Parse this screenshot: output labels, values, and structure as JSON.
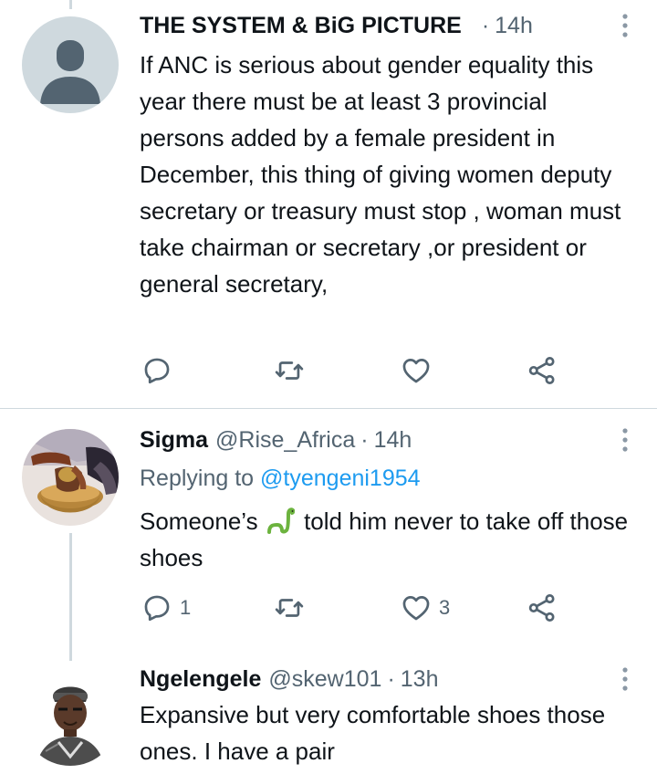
{
  "tweets": [
    {
      "name": "THE SYSTEM & BiG PICTURE",
      "handle": "",
      "time": "14h",
      "body": "If ANC is serious about gender equality this year there must be at least 3 provincial persons added by a female president in December,  this thing of giving women deputy secretary or treasury must stop , woman must take chairman or secretary ,or president or general secretary,",
      "reply_count": "",
      "retweet_count": "",
      "like_count": ""
    },
    {
      "name": "Sigma",
      "handle": "@Rise_Africa",
      "time": "14h",
      "replying_prefix": "Replying to",
      "replying_to": "@tyengeni1954",
      "body_before_emoji": "Someone’s",
      "emoji": "snake",
      "body_after_emoji": "told him never to take off those shoes",
      "reply_count": "1",
      "retweet_count": "",
      "like_count": "3"
    },
    {
      "name": "Ngelengele",
      "handle": "@skew101",
      "time": "13h",
      "body": "Expansive but very comfortable shoes those ones. I have a pair"
    }
  ],
  "icons": [
    "reply-icon",
    "retweet-icon",
    "like-icon",
    "share-icon",
    "more-icon"
  ],
  "colors": {
    "text": "#0f1419",
    "secondary": "#536471",
    "link": "#1d9bf0",
    "divider": "#cfd9de"
  }
}
